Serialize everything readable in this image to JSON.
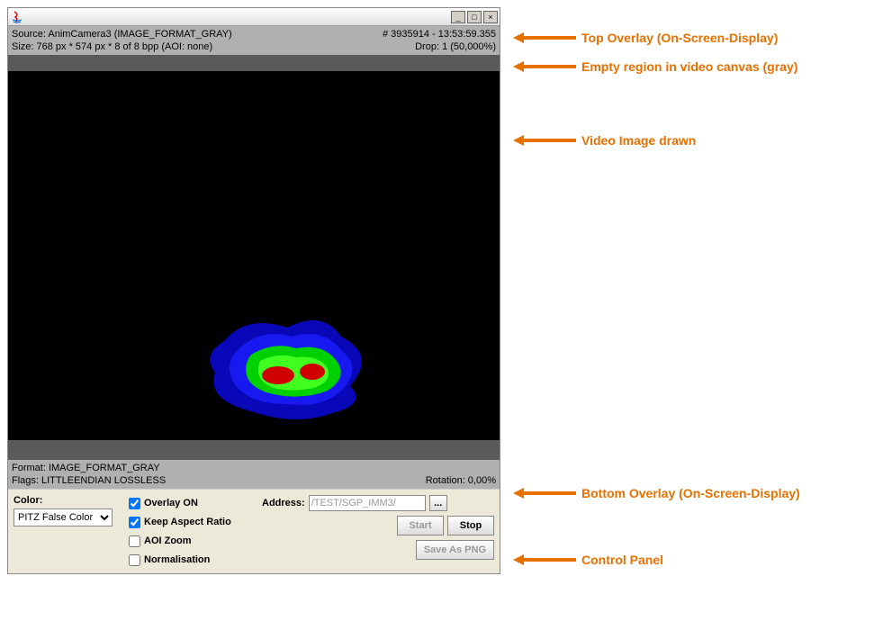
{
  "titlebar": {
    "btn_min": "_",
    "btn_max": "□",
    "btn_close": "×"
  },
  "top_overlay": {
    "source": "Source: AnimCamera3 (IMAGE_FORMAT_GRAY)",
    "frameinfo": "# 3935914 - 13:53:59.355",
    "size": "Size: 768 px * 574 px * 8 of 8 bpp   (AOI: none)",
    "drop": "Drop: 1 (50,000%)"
  },
  "bottom_overlay": {
    "format": "Format: IMAGE_FORMAT_GRAY",
    "flags": "Flags: LITTLEENDIAN LOSSLESS",
    "rotation": "Rotation: 0,00%"
  },
  "controls": {
    "color_label": "Color:",
    "color_value": "PITZ False Color",
    "cb_overlay": "Overlay ON",
    "cb_keepaspect": "Keep Aspect Ratio",
    "cb_aoizoom": "AOI Zoom",
    "cb_normalisation": "Normalisation",
    "checked": {
      "overlay": true,
      "keepaspect": true,
      "aoizoom": false,
      "normalisation": false
    },
    "address_label": "Address:",
    "address_value": "/TEST/SGP_IMM3/",
    "btn_ellipsis": "...",
    "btn_start": "Start",
    "btn_stop": "Stop",
    "btn_saveas": "Save As PNG"
  },
  "annotations": {
    "top_overlay": "Top Overlay (On-Screen-Display)",
    "empty_region": "Empty region in video canvas (gray)",
    "video_image": "Video Image drawn",
    "bottom_overlay": "Bottom Overlay (On-Screen-Display)",
    "control_panel": "Control Panel"
  }
}
